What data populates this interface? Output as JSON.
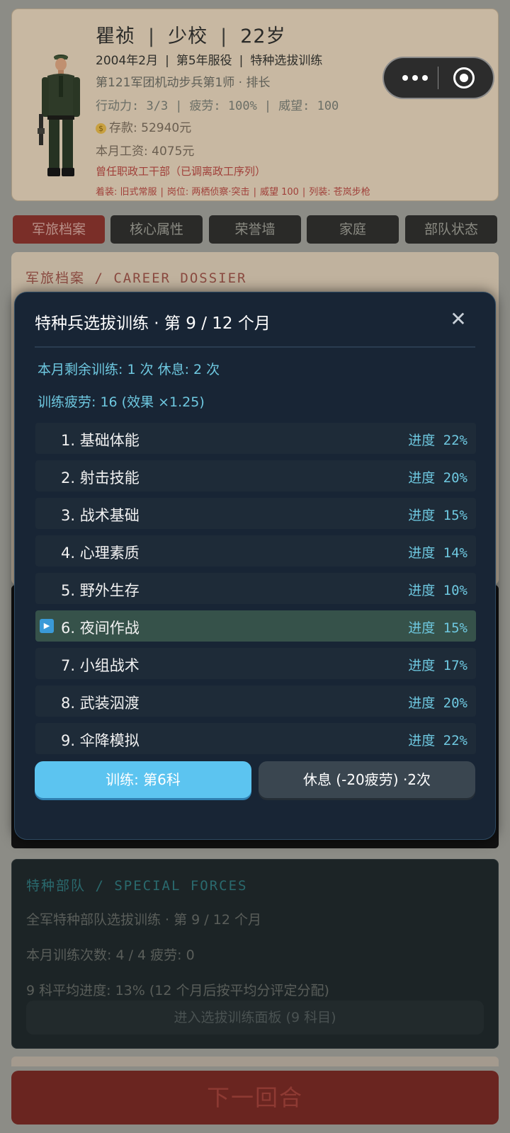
{
  "profile": {
    "name": "瞿祯",
    "rank": "少校",
    "age": "22岁",
    "enlist_date": "2004年2月",
    "service_year": "第5年服役",
    "current_activity": "特种选拔训练",
    "unit": "第121军团机动步兵第1师 · 排长",
    "action_points": "行动力: 3/3",
    "fatigue": "疲劳: 100%",
    "prestige": "威望: 100",
    "savings": "存款: 52940元",
    "salary": "本月工资: 4075元",
    "former_role": "曾任职政工干部（已调离政工序列）",
    "attire": "着装: 旧式常服",
    "post": "岗位: 两栖侦察·突击",
    "attire_prestige": "威望 100",
    "weapon": "列装: 苍岚步枪"
  },
  "tabs": [
    "军旅档案",
    "核心属性",
    "荣誉墙",
    "家庭",
    "部队状态"
  ],
  "dossier": {
    "title": "军旅档案 / CAREER DOSSIER"
  },
  "modal": {
    "title": "特种兵选拔训练 · 第 9 / 12 个月",
    "remaining": "本月剩余训练: 1 次  休息: 2 次",
    "fatigue_line": "训练疲劳: 16 (效果 ×1.25)",
    "subjects": [
      {
        "label": "1. 基础体能",
        "progress_text": "进度 22%",
        "progress": 22
      },
      {
        "label": "2. 射击技能",
        "progress_text": "进度 20%",
        "progress": 20
      },
      {
        "label": "3. 战术基础",
        "progress_text": "进度 15%",
        "progress": 15
      },
      {
        "label": "4. 心理素质",
        "progress_text": "进度 14%",
        "progress": 14
      },
      {
        "label": "5. 野外生存",
        "progress_text": "进度 10%",
        "progress": 10
      },
      {
        "label": "6. 夜间作战",
        "progress_text": "进度 15%",
        "progress": 15,
        "selected": true
      },
      {
        "label": "7. 小组战术",
        "progress_text": "进度 17%",
        "progress": 17
      },
      {
        "label": "8. 武装泅渡",
        "progress_text": "进度 20%",
        "progress": 20
      },
      {
        "label": "9. 伞降模拟",
        "progress_text": "进度 22%",
        "progress": 22
      }
    ],
    "train_button": "训练: 第6科",
    "rest_button": "休息 (-20疲劳) ·2次"
  },
  "special_forces": {
    "title": "特种部队 / SPECIAL FORCES",
    "line1": "全军特种部队选拔训练 · 第 9 / 12 个月",
    "line2": "本月训练次数: 4 / 4  疲劳: 0",
    "line3": "9 科平均进度: 13% (12 个月后按平均分评定分配)",
    "button": "进入选拔训练面板 (9 科目)"
  },
  "next_turn_button": "下一回合",
  "colors": {
    "accent": "#5cc4f0",
    "modal_bg": "#182535",
    "progress_text": "#6ec8e0",
    "danger_red": "#a0403a"
  },
  "icons": [
    "soldier-portrait",
    "coin-icon",
    "more-icon",
    "target-icon",
    "close-icon",
    "play-arrow-icon"
  ]
}
